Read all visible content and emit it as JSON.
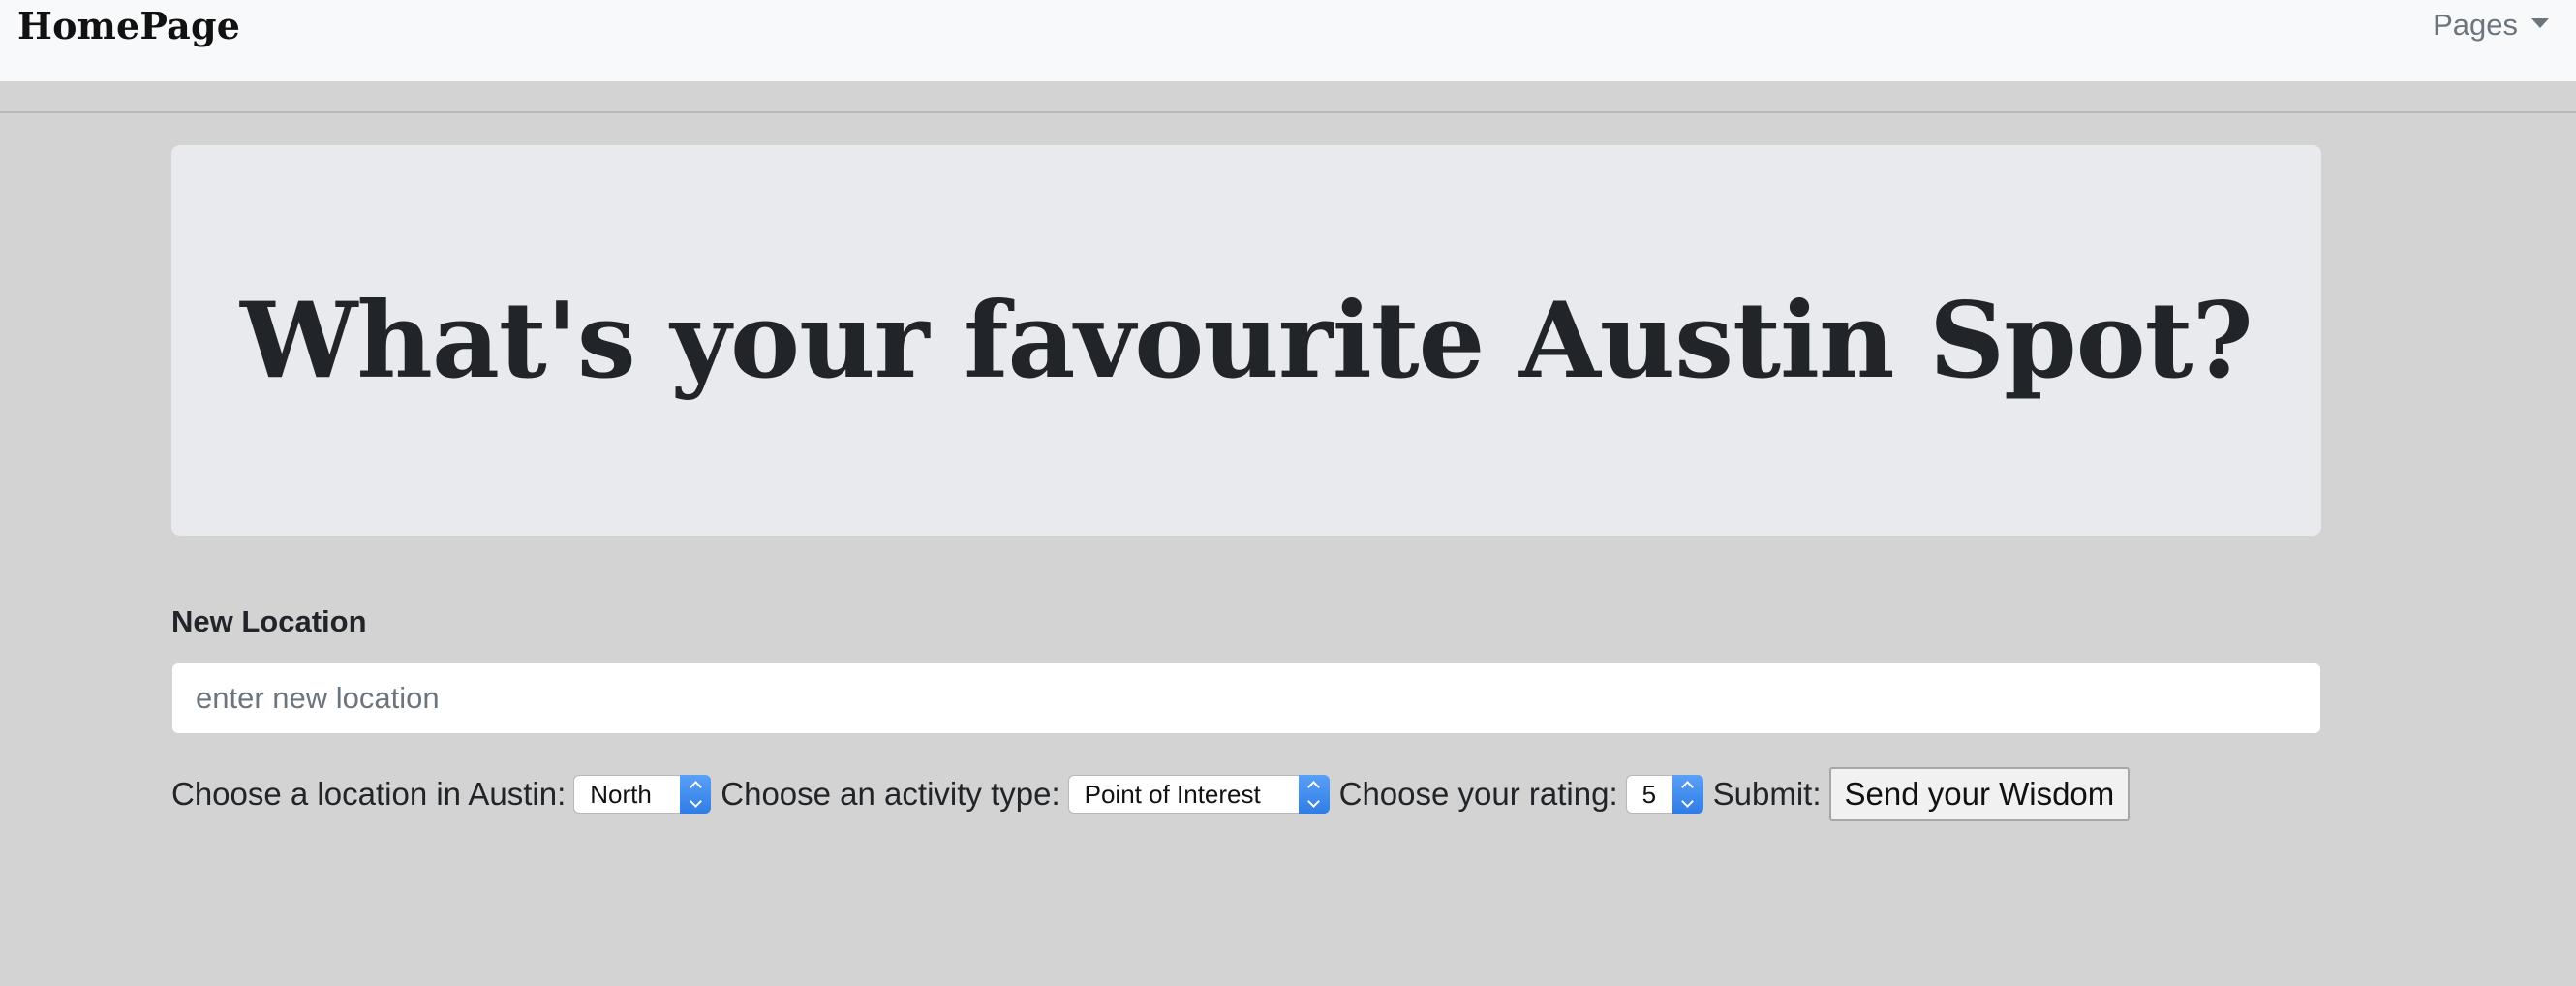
{
  "navbar": {
    "brand": "HomePage",
    "dropdown_label": "Pages"
  },
  "hero": {
    "title": "What's your favourite Austin Spot?"
  },
  "form": {
    "location_label": "New Location",
    "location_placeholder": "enter new location",
    "location_value": "",
    "area_label": "Choose a location in Austin:",
    "area_selected": "North",
    "activity_label": "Choose an activity type:",
    "activity_selected": "Point of Interest",
    "rating_label": "Choose your rating:",
    "rating_selected": "5",
    "submit_label": "Submit:",
    "submit_button": "Send your Wisdom"
  },
  "colors": {
    "page_background": "#d3d3d3",
    "navbar_background": "#f8f9fa",
    "jumbotron_background": "#e9eaee",
    "select_stepper_accent": "#2f7de6"
  },
  "icons": {
    "dropdown_caret": "caret-down-icon",
    "select_stepper": "up-down-chevron-icon"
  }
}
